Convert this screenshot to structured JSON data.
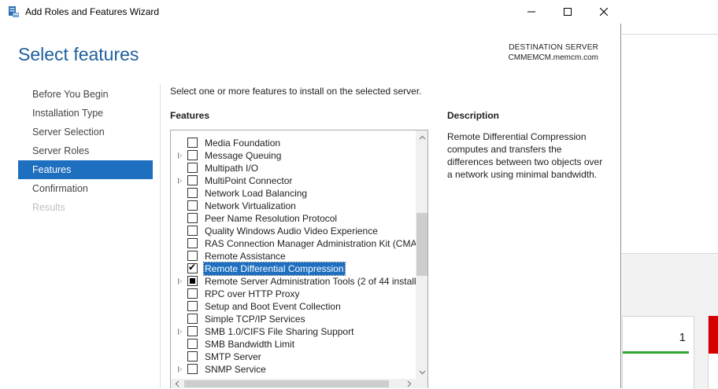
{
  "window": {
    "title": "Add Roles and Features Wizard",
    "icon": "server-manager-icon"
  },
  "header": {
    "page_title": "Select features",
    "destination_label": "DESTINATION SERVER",
    "destination_server": "CMMEMCM.memcm.com"
  },
  "nav": {
    "items": [
      {
        "label": "Before You Begin",
        "state": "normal"
      },
      {
        "label": "Installation Type",
        "state": "normal"
      },
      {
        "label": "Server Selection",
        "state": "normal"
      },
      {
        "label": "Server Roles",
        "state": "normal"
      },
      {
        "label": "Features",
        "state": "active"
      },
      {
        "label": "Confirmation",
        "state": "normal"
      },
      {
        "label": "Results",
        "state": "disabled"
      }
    ]
  },
  "content": {
    "instruction": "Select one or more features to install on the selected server.",
    "features_heading": "Features",
    "features": [
      {
        "label": "Media Foundation",
        "expandable": false,
        "state": "unchecked"
      },
      {
        "label": "Message Queuing",
        "expandable": true,
        "state": "unchecked"
      },
      {
        "label": "Multipath I/O",
        "expandable": false,
        "state": "unchecked"
      },
      {
        "label": "MultiPoint Connector",
        "expandable": true,
        "state": "unchecked"
      },
      {
        "label": "Network Load Balancing",
        "expandable": false,
        "state": "unchecked"
      },
      {
        "label": "Network Virtualization",
        "expandable": false,
        "state": "unchecked"
      },
      {
        "label": "Peer Name Resolution Protocol",
        "expandable": false,
        "state": "unchecked"
      },
      {
        "label": "Quality Windows Audio Video Experience",
        "expandable": false,
        "state": "unchecked"
      },
      {
        "label": "RAS Connection Manager Administration Kit (CMA",
        "expandable": false,
        "state": "unchecked"
      },
      {
        "label": "Remote Assistance",
        "expandable": false,
        "state": "unchecked"
      },
      {
        "label": "Remote Differential Compression",
        "expandable": false,
        "state": "checked",
        "selected": true
      },
      {
        "label": "Remote Server Administration Tools (2 of 44 install",
        "expandable": true,
        "state": "indeterminate"
      },
      {
        "label": "RPC over HTTP Proxy",
        "expandable": false,
        "state": "unchecked"
      },
      {
        "label": "Setup and Boot Event Collection",
        "expandable": false,
        "state": "unchecked"
      },
      {
        "label": "Simple TCP/IP Services",
        "expandable": false,
        "state": "unchecked"
      },
      {
        "label": "SMB 1.0/CIFS File Sharing Support",
        "expandable": true,
        "state": "unchecked"
      },
      {
        "label": "SMB Bandwidth Limit",
        "expandable": false,
        "state": "unchecked"
      },
      {
        "label": "SMTP Server",
        "expandable": false,
        "state": "unchecked"
      },
      {
        "label": "SNMP Service",
        "expandable": true,
        "state": "unchecked"
      }
    ],
    "description_heading": "Description",
    "description_text": "Remote Differential Compression computes and transfers the differences between two objects over a network using minimal bandwidth."
  },
  "background": {
    "tile_count": "1"
  },
  "colors": {
    "accent": "#1e6fc0",
    "title_blue": "#1e5e9c",
    "status_green": "#2fa62f",
    "status_red": "#d60000"
  }
}
